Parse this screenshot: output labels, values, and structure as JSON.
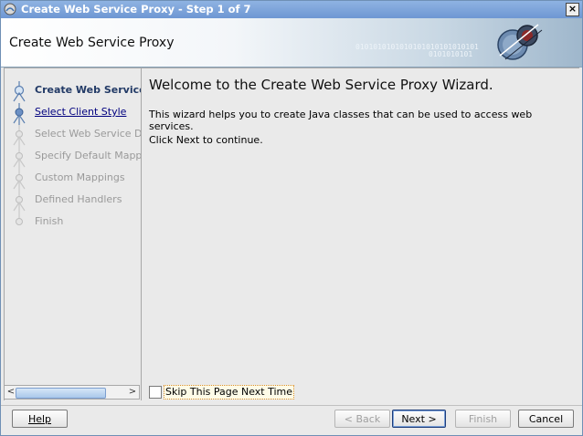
{
  "window": {
    "title": "Create Web Service Proxy - Step 1 of 7",
    "close_glyph": "×"
  },
  "banner": {
    "title": "Create Web Service Proxy",
    "binary_line1": "0101010101010101010101010101",
    "binary_line2": "0101010101"
  },
  "steps": [
    {
      "label": "Create Web Service Proxy",
      "state": "active"
    },
    {
      "label": "Select Client Style",
      "state": "link"
    },
    {
      "label": "Select Web Service Description",
      "state": "disabled"
    },
    {
      "label": "Specify Default Mapping Options",
      "state": "disabled"
    },
    {
      "label": "Custom Mappings",
      "state": "disabled"
    },
    {
      "label": "Defined Handlers",
      "state": "disabled"
    },
    {
      "label": "Finish",
      "state": "disabled"
    }
  ],
  "scroll": {
    "left_glyph": "<",
    "right_glyph": ">"
  },
  "content": {
    "heading": "Welcome to the Create Web Service Proxy Wizard.",
    "description": "This wizard helps you to create Java classes that can be used to access web services.",
    "hint": "Click Next to continue."
  },
  "skip_checkbox": {
    "label": "Skip This Page Next Time",
    "checked": false
  },
  "buttons": {
    "help": "Help",
    "back": "< Back",
    "next": "Next >",
    "finish": "Finish",
    "cancel": "Cancel"
  },
  "colors": {
    "title_bar": "#7ba2dc",
    "active_step": "#223a66",
    "link_step": "#00007f",
    "disabled_step": "#9a9a9a"
  }
}
